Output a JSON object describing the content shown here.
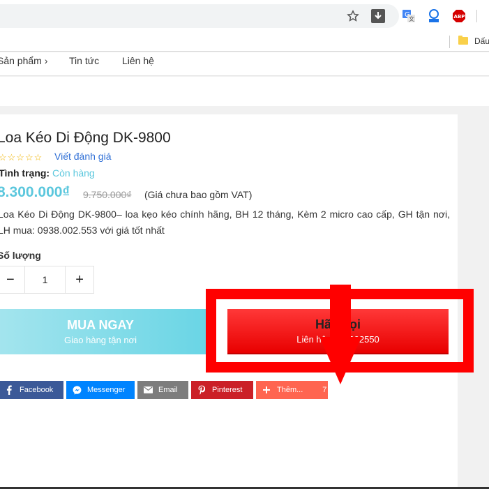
{
  "browser": {
    "bookmark_folder_label": "Dấu"
  },
  "nav": {
    "items": [
      {
        "label": "Sản phẩm ›"
      },
      {
        "label": "Tin tức"
      },
      {
        "label": "Liên hệ"
      }
    ]
  },
  "product": {
    "title": "Loa Kéo Di Động DK-9800",
    "stars_rating": 0,
    "stars_max": 5,
    "stars_glyphs": "☆☆☆☆☆",
    "review_link": "Viết đánh giá",
    "status_label": "Tình trạng:",
    "status_value": "Còn hàng",
    "price": "8.300.000₫",
    "old_price": "9.750.000₫",
    "vat_note": "(Giá chưa bao gồm VAT)",
    "description": "Loa Kéo Di Động DK-9800– loa kẹo kéo chính hãng, BH 12 tháng, Kèm 2 micro cao cấp, GH tận nơi, LH mua: 0938.002.553 với giá tốt nhất",
    "quantity_label": "Số lượng",
    "quantity_value": "1",
    "minus": "−",
    "plus": "+"
  },
  "buy_button": {
    "label": "MUA NGAY",
    "sublabel": "Giao hàng tận nơi"
  },
  "call_button": {
    "label": "Hãy gọi",
    "sublabel": "Liên hệ 0938002550"
  },
  "share": [
    {
      "label": "Facebook",
      "color": "#3b5998",
      "icon": "facebook-icon"
    },
    {
      "label": "Messenger",
      "color": "#0084ff",
      "icon": "messenger-icon"
    },
    {
      "label": "Email",
      "color": "#7d7d7d",
      "icon": "email-icon"
    },
    {
      "label": "Pinterest",
      "color": "#cb2027",
      "icon": "pinterest-icon"
    },
    {
      "label": "Thêm...",
      "color": "#ff6550",
      "icon": "plus-icon",
      "count": "7"
    }
  ],
  "colors": {
    "accent": "#5bc7dd",
    "highlight": "#ff0000",
    "call_button": "#f01010"
  }
}
